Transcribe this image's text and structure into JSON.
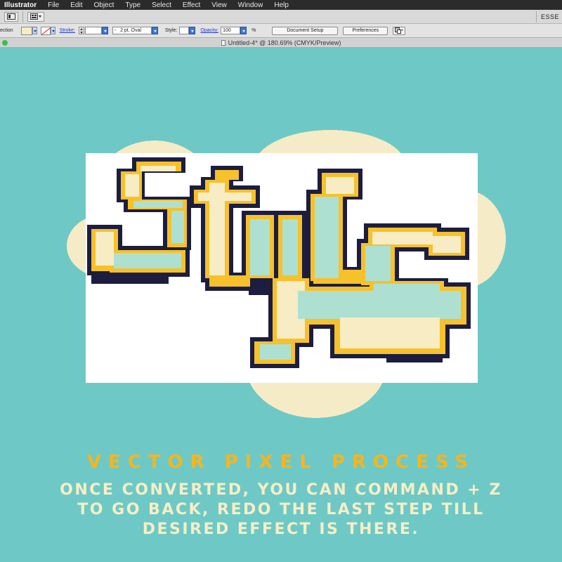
{
  "menubar": {
    "app_name": "Illustrator",
    "items": [
      "File",
      "Edit",
      "Object",
      "Type",
      "Select",
      "Effect",
      "View",
      "Window",
      "Help"
    ]
  },
  "appbar": {
    "workspace": "ESSE"
  },
  "control": {
    "selection_label": "ection",
    "stroke_label": "Stroke:",
    "brush_value": "2 pt. Oval",
    "brush_prefix": "-",
    "style_label": "Style:",
    "opacity_label": "Opacity:",
    "opacity_value": "100",
    "opacity_unit": "%",
    "document_setup": "Document Setup",
    "preferences": "Preferences",
    "fill_color": "#f7ecc3"
  },
  "document": {
    "title": "Untitled-4* @ 180.69% (CMYK/Preview)"
  },
  "artwork": {
    "word": "Style",
    "colors": {
      "outline": "#1c1d3f",
      "gold": "#f6c12a",
      "cream": "#f7ecc3",
      "mint": "#aee0d2",
      "halo": "#f5ebc6",
      "artboard": "#ffffff"
    }
  },
  "footer": {
    "headline": "VECTOR PIXEL PROCESS",
    "line1": "ONCE CONVERTED, YOU CAN COMMAND + Z",
    "line2": "TO GO BACK, REDO THE LAST STEP TILL",
    "line3": "DESIRED EFFECT IS THERE."
  }
}
